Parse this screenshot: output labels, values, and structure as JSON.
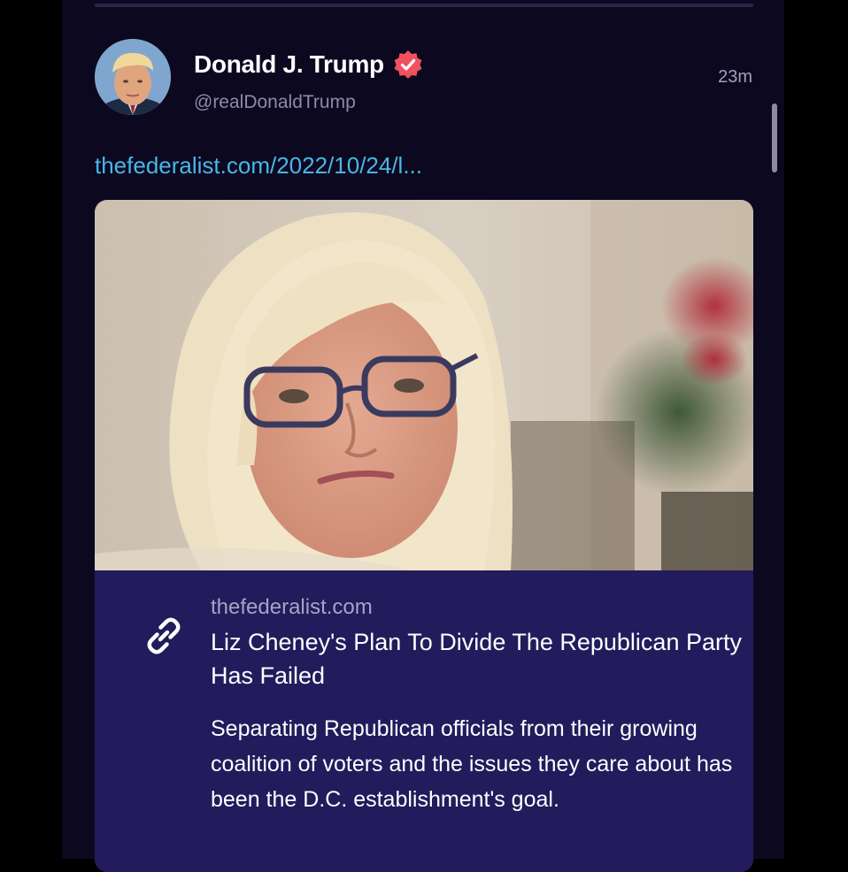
{
  "post": {
    "author": {
      "display_name": "Donald J. Trump",
      "handle": "@realDonaldTrump",
      "verified": true,
      "verified_color": "#f1515e",
      "avatar_icon": "profile-photo"
    },
    "timestamp": "23m",
    "link_text": "thefederalist.com/2022/10/24/l...",
    "link_color": "#4ab6e6"
  },
  "card": {
    "image_icon": "article-photo",
    "link_icon": "link-icon",
    "domain": "thefederalist.com",
    "title": "Liz Cheney's Plan To Divide The Republican Party Has Failed",
    "description": "Separating Republican officials from their growing coalition of voters and the issues they care about has been the D.C. establishment's goal."
  },
  "colors": {
    "feed_background": "#0b0820",
    "card_background": "#221b5c"
  }
}
